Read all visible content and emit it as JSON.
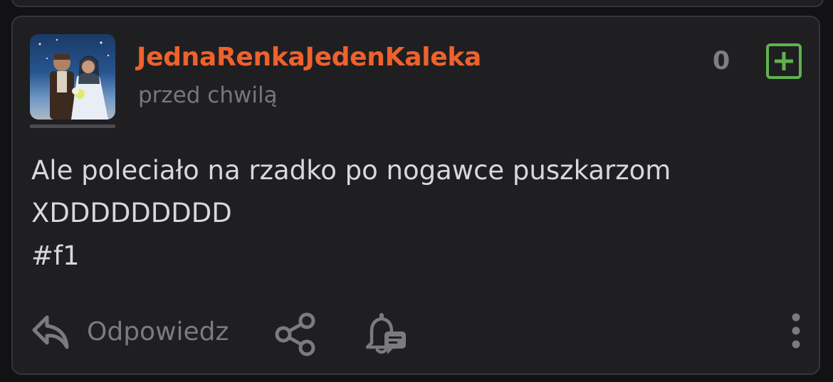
{
  "post": {
    "username": "JednaRenkaJedenKaleka",
    "time": "przed chwilą",
    "vote_count": "0",
    "content_lines": [
      "Ale poleciało na rzadko po nogawce puszkarzom",
      "XDDDDDDDDD",
      "#f1"
    ]
  },
  "actions": {
    "reply_label": "Odpowiedz"
  },
  "colors": {
    "username": "#f0612b",
    "plus_button": "#5fb24d",
    "card_background": "#1f1f22",
    "muted_text": "#76767c"
  },
  "icons": [
    "reply-icon",
    "share-icon",
    "bell-comment-icon",
    "plus-icon",
    "more-vertical-icon"
  ]
}
